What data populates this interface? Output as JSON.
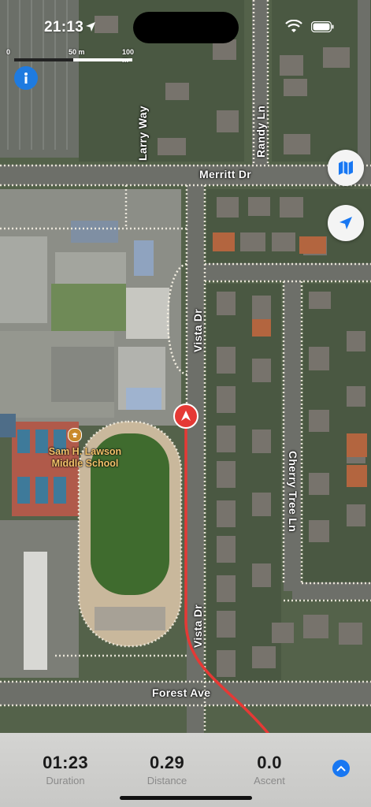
{
  "status_bar": {
    "time": "21:13"
  },
  "scale": {
    "zero": "0",
    "mid": "50 m",
    "end": "100 m"
  },
  "map": {
    "streets": {
      "larry_way": "Larry Way",
      "randy_ln": "Randy Ln",
      "merritt_dr": "Merritt Dr",
      "vista_dr_upper": "Vista Dr",
      "vista_dr_lower": "Vista Dr",
      "cherry_tree_ln": "Cherry Tree Ln",
      "forest_ave": "Forest Ave"
    },
    "poi": {
      "line1": "Sam H. Lawson",
      "line2": "Middle School"
    },
    "colors": {
      "route": "#e53935",
      "accent": "#1877f2",
      "road": "#f4efe2"
    }
  },
  "buttons": {
    "info_icon": "info-icon",
    "map_icon": "map-icon",
    "locate_icon": "location-arrow-icon",
    "expand_icon": "chevron-up-icon"
  },
  "stats": [
    {
      "value": "01:23",
      "label": "Duration"
    },
    {
      "value": "0.29",
      "label": "Distance"
    },
    {
      "value": "0.0",
      "label": "Ascent"
    }
  ]
}
